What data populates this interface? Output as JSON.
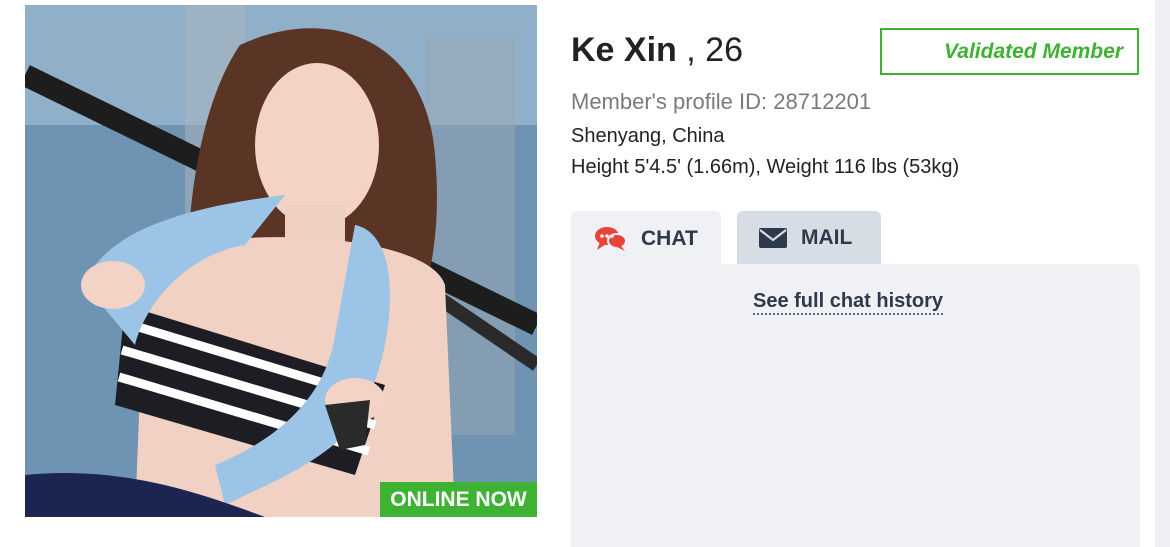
{
  "profile": {
    "name": "Ke Xin",
    "age_text": ", 26",
    "validated_label": "Validated Member",
    "profile_id_text": "Member's profile ID: 28712201",
    "location": "Shenyang, China",
    "measurements": "Height 5'4.5' (1.66m), Weight 116 lbs (53kg)"
  },
  "photo": {
    "online_label": "ONLINE NOW"
  },
  "tabs": [
    {
      "label": "CHAT",
      "icon": "chat-bubbles-icon",
      "active": true
    },
    {
      "label": "MAIL",
      "icon": "envelope-icon",
      "active": false
    }
  ],
  "chat_panel": {
    "history_link": "See full chat history"
  },
  "colors": {
    "accent_green": "#3db233",
    "chat_icon_red": "#e8423a",
    "text_dark": "#2e3a4a",
    "panel_bg": "#f0f1f4",
    "inactive_tab_bg": "#d7dde5"
  }
}
